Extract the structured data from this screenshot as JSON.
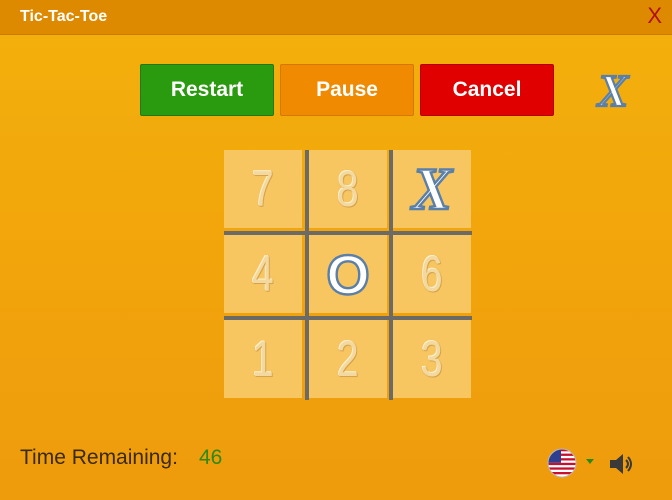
{
  "window": {
    "title": "Tic-Tac-Toe",
    "close_label": "X"
  },
  "toolbar": {
    "restart_label": "Restart",
    "pause_label": "Pause",
    "cancel_label": "Cancel",
    "current_turn": "X"
  },
  "board": {
    "cells": [
      {
        "key": "7",
        "mark": ""
      },
      {
        "key": "8",
        "mark": ""
      },
      {
        "key": "9",
        "mark": "X"
      },
      {
        "key": "4",
        "mark": ""
      },
      {
        "key": "5",
        "mark": "O"
      },
      {
        "key": "6",
        "mark": ""
      },
      {
        "key": "1",
        "mark": ""
      },
      {
        "key": "2",
        "mark": ""
      },
      {
        "key": "3",
        "mark": ""
      }
    ]
  },
  "footer": {
    "time_label": "Time Remaining:",
    "time_value": "46",
    "language_icon": "us-flag-icon",
    "sound_icon": "speaker-icon"
  },
  "colors": {
    "restart": "#2a9a0f",
    "pause": "#f08a00",
    "cancel": "#e00000",
    "titlebar": "#de8a00",
    "time_value": "#2b8a12"
  }
}
